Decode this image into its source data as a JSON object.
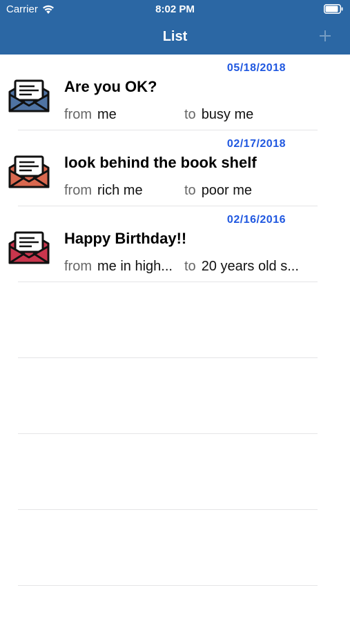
{
  "status": {
    "carrier": "Carrier",
    "time": "8:02 PM"
  },
  "nav": {
    "title": "List",
    "add_icon": "plus-icon"
  },
  "items": [
    {
      "date": "05/18/2018",
      "title": "Are you OK?",
      "from_label": "from",
      "from": "me",
      "to_label": "to",
      "to": "busy me",
      "icon_color": "#4f73a3"
    },
    {
      "date": "02/17/2018",
      "title": "look behind the book shelf",
      "from_label": "from",
      "from": "rich me",
      "to_label": "to",
      "to": "poor me",
      "icon_color": "#d9684f"
    },
    {
      "date": "02/16/2016",
      "title": "Happy Birthday!!",
      "from_label": "from",
      "from": "me in high...",
      "to_label": "to",
      "to": "20 years old s...",
      "icon_color": "#c9364d"
    }
  ],
  "colors": {
    "header": "#2b67a4",
    "date": "#1f57e0"
  }
}
